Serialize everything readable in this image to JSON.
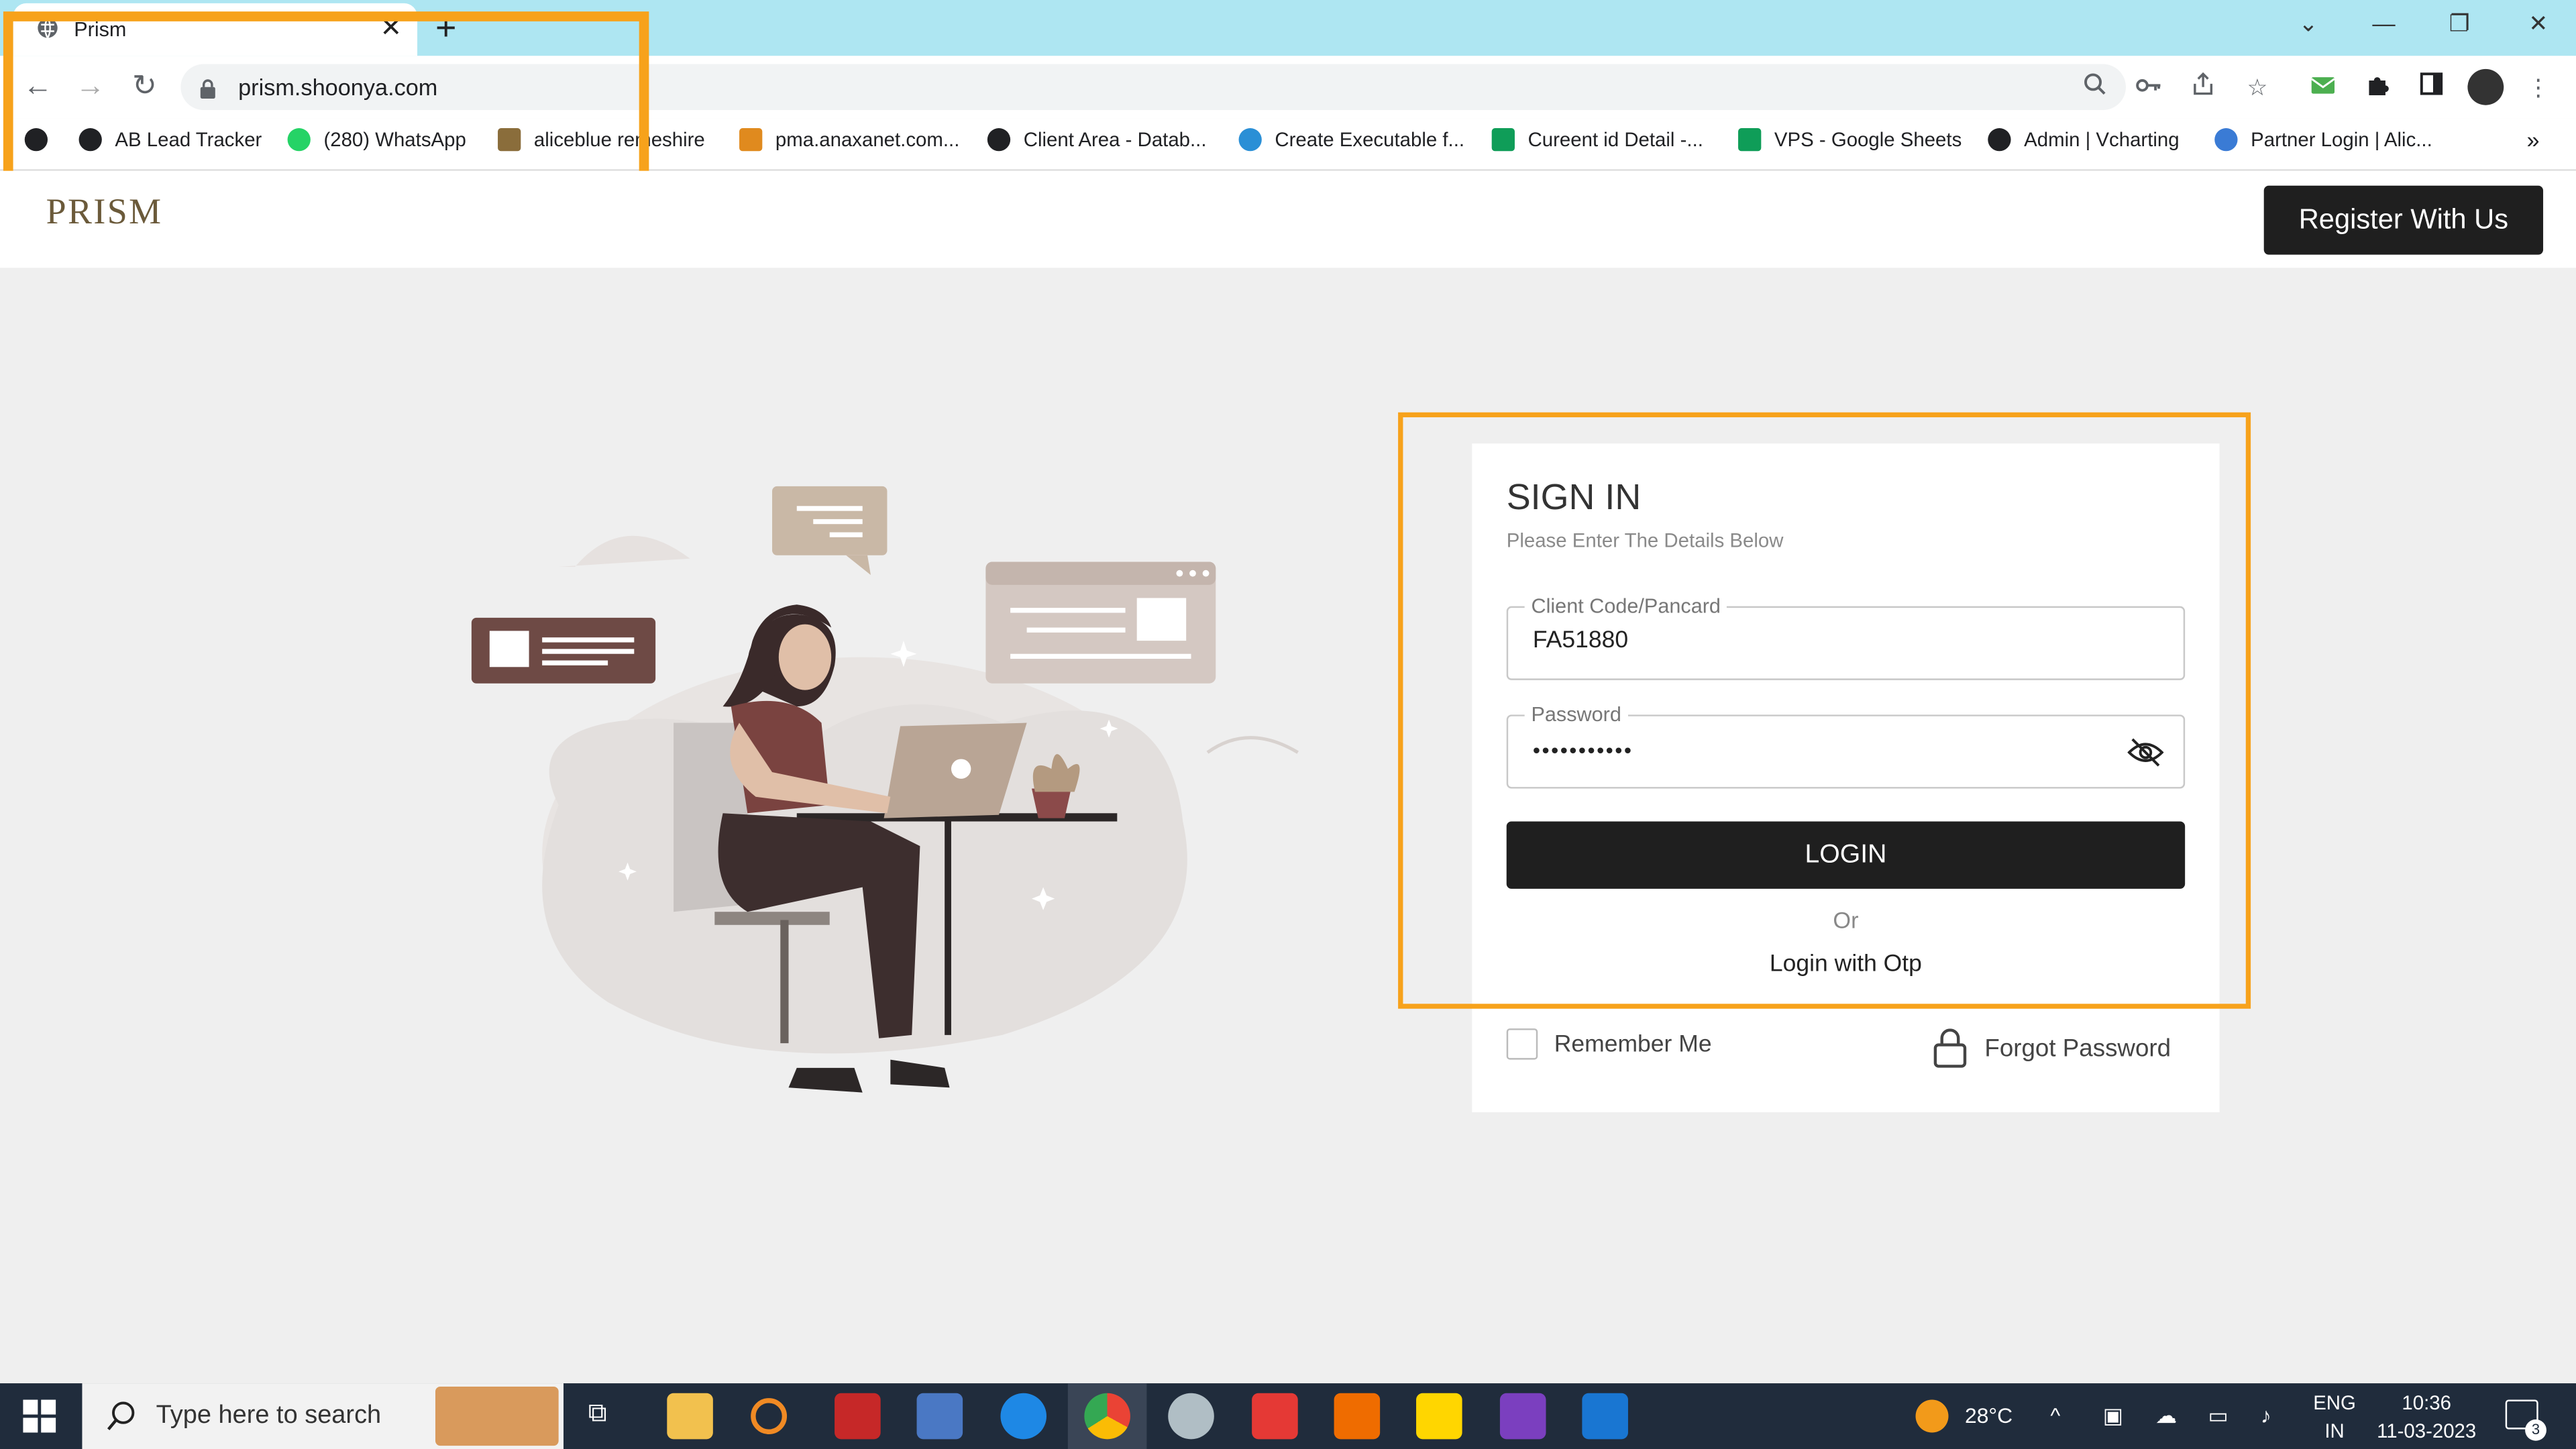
{
  "browser": {
    "tab_title": "Prism",
    "url": "prism.shoonya.com",
    "new_tab_symbol": "+",
    "bookmarks": [
      {
        "label": "",
        "icon": "globe-icon",
        "color": "#202124"
      },
      {
        "label": "AB Lead Tracker",
        "icon": "globe-icon",
        "color": "#202124"
      },
      {
        "label": "(280) WhatsApp",
        "icon": "whatsapp-icon",
        "color": "#25d366"
      },
      {
        "label": "aliceblue remeshire",
        "icon": "image-icon",
        "color": "#8a6d3b"
      },
      {
        "label": "pma.anaxanet.com...",
        "icon": "pma-icon",
        "color": "#e08a1e"
      },
      {
        "label": "Client Area - Datab...",
        "icon": "globe-icon",
        "color": "#202124"
      },
      {
        "label": "Create Executable f...",
        "icon": "fish-icon",
        "color": "#2a8fd6"
      },
      {
        "label": "Cureent id Detail -...",
        "icon": "sheets-icon",
        "color": "#0f9d58"
      },
      {
        "label": "VPS - Google Sheets",
        "icon": "sheets-icon",
        "color": "#0f9d58"
      },
      {
        "label": "Admin | Vcharting",
        "icon": "globe-icon",
        "color": "#202124"
      },
      {
        "label": "Partner Login | Alic...",
        "icon": "link-icon",
        "color": "#3a7bd5"
      }
    ],
    "bookmarks_more": "»"
  },
  "header": {
    "logo_text": "PRISM",
    "register_label": "Register With Us"
  },
  "signin": {
    "title": "SIGN IN",
    "subtitle": "Please Enter The Details Below",
    "client_label": "Client Code/Pancard",
    "client_value": "FA51880",
    "password_label": "Password",
    "password_value": "•••••••••••",
    "login_label": "LOGIN",
    "or_label": "Or",
    "otp_label": "Login with Otp",
    "remember_label": "Remember Me",
    "forgot_label": "Forgot Password"
  },
  "taskbar": {
    "search_placeholder": "Type here to search",
    "temperature": "28°C",
    "language_top": "ENG",
    "language_bottom": "IN",
    "time": "10:36",
    "date": "11-03-2023",
    "notification_count": "3"
  },
  "colors": {
    "tabbar": "#aee6f2",
    "highlight": "#f7a21b",
    "button_dark": "#1f1f1f",
    "taskbar": "#202c3c"
  }
}
